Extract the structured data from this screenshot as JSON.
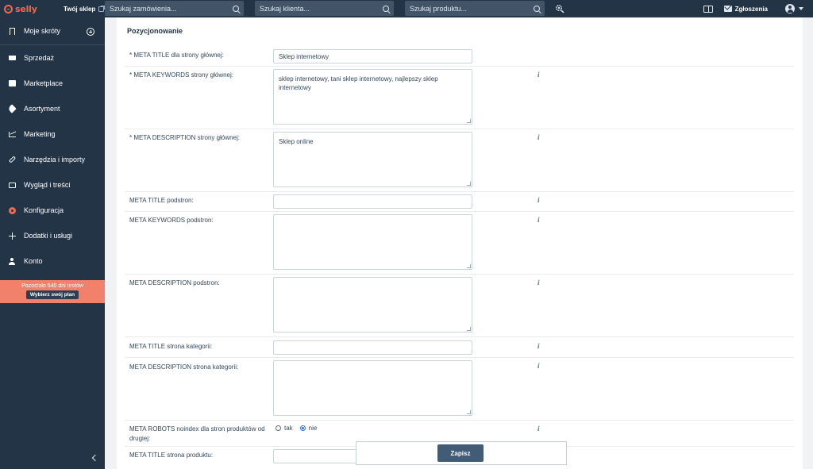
{
  "topbar": {
    "logo_text": "selly",
    "shop_link": "Twój sklep",
    "search_orders_placeholder": "Szukaj zamówienia...",
    "search_clients_placeholder": "Szukaj klienta...",
    "search_products_placeholder": "Szukaj produktu...",
    "tickets_label": "Zgłoszenia"
  },
  "sidebar": {
    "items": [
      {
        "label": "Moje skróty",
        "icon": "bookmark-icon"
      },
      {
        "label": "Sprzedaż",
        "icon": "cart-icon"
      },
      {
        "label": "Marketplace",
        "icon": "store-icon"
      },
      {
        "label": "Asortyment",
        "icon": "tag-icon"
      },
      {
        "label": "Marketing",
        "icon": "chart-icon"
      },
      {
        "label": "Narzędzia i importy",
        "icon": "link-icon"
      },
      {
        "label": "Wygląd i treści",
        "icon": "monitor-icon"
      },
      {
        "label": "Konfiguracja",
        "icon": "gear-icon"
      },
      {
        "label": "Dodatki i usługi",
        "icon": "plus-icon"
      },
      {
        "label": "Konto",
        "icon": "person-icon"
      }
    ],
    "trial_text": "Pozostało 540 dni testów",
    "trial_button": "Wybierz swój plan"
  },
  "main": {
    "section_title": "Pozycjonowanie",
    "fields": {
      "meta_title_home": {
        "label": "* META TITLE dla strony głównej:",
        "value": "Sklep internetowy"
      },
      "meta_keywords_home": {
        "label": "* META KEYWORDS strony głównej:",
        "value": "sklep internetowy, tani sklep internetowy, najlepszy sklep internetowy"
      },
      "meta_description_home": {
        "label": "* META DESCRIPTION strony głównej:",
        "value": "Sklep online"
      },
      "meta_title_subpages": {
        "label": "META TITLE podstron:",
        "value": ""
      },
      "meta_keywords_subpages": {
        "label": "META KEYWORDS podstron:",
        "value": ""
      },
      "meta_description_subpages": {
        "label": "META DESCRIPTION podstron:",
        "value": ""
      },
      "meta_title_category": {
        "label": "META TITLE strona kategorii:",
        "value": ""
      },
      "meta_description_category": {
        "label": "META DESCRIPTION strona kategorii:",
        "value": ""
      },
      "meta_robots": {
        "label": "META ROBOTS noindex dla stron produktów od drugiej:",
        "option_yes": "tak",
        "option_no": "nie",
        "selected": "nie"
      },
      "meta_title_product": {
        "label": "META TITLE strona produktu:",
        "value": ""
      }
    },
    "info_glyph": "i",
    "save_label": "Zapisz"
  },
  "colors": {
    "sidebar_bg": "#243447",
    "accent": "#f2694e",
    "save_button": "#425b76",
    "radio_selected": "#2b6fe8"
  }
}
